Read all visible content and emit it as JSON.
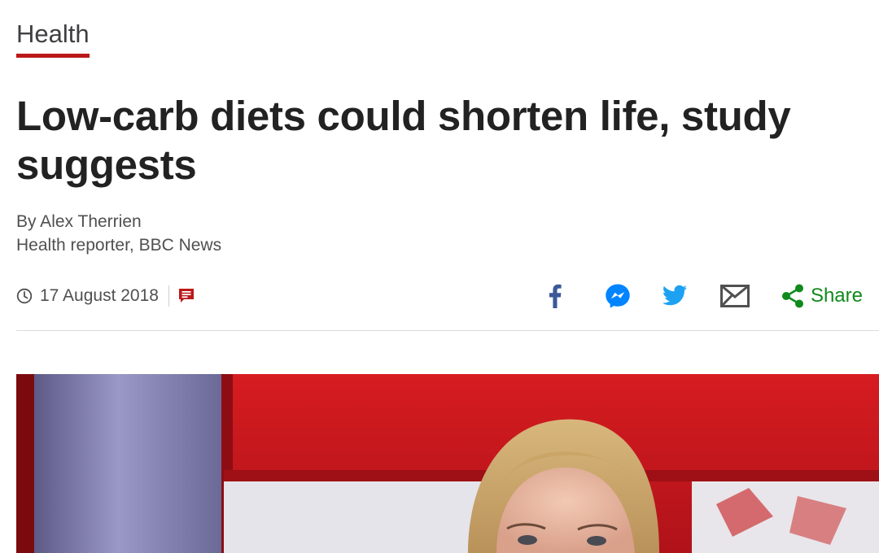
{
  "section": {
    "label": "Health",
    "accent_color": "#bb1919"
  },
  "article": {
    "headline": "Low-carb diets could shorten life, study suggests",
    "byline": {
      "author": "By Alex Therrien",
      "role": "Health reporter, BBC News"
    },
    "date": "17 August 2018"
  },
  "share_bar": {
    "icons": [
      "facebook-icon",
      "messenger-icon",
      "twitter-icon",
      "email-icon",
      "share-icon"
    ],
    "share_label": "Share",
    "colors": {
      "facebook": "#3b5998",
      "messenger": "#0084ff",
      "twitter": "#1da1f2",
      "email": "#505050",
      "share": "#108a1c"
    }
  },
  "hero_image": {
    "description_icon": "photo",
    "dominant_colors": [
      "#c8171a",
      "#8a89b8",
      "#e6e6ea"
    ]
  }
}
